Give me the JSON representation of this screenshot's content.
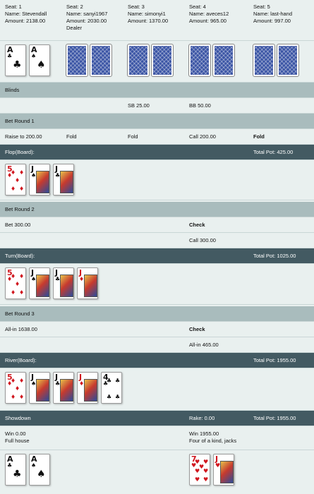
{
  "seats": [
    {
      "seat": "Seat: 1",
      "name": "Name: Stevendall",
      "amount": "Amount: 2138.00",
      "extra": ""
    },
    {
      "seat": "Seat: 2",
      "name": "Name: sanyi1967",
      "amount": "Amount: 2030.00",
      "extra": "Dealer"
    },
    {
      "seat": "Seat: 3",
      "name": "Name: simonyi1",
      "amount": "Amount: 1370.00",
      "extra": ""
    },
    {
      "seat": "Seat: 4",
      "name": "Name: aveces12",
      "amount": "Amount: 965.00",
      "extra": ""
    },
    {
      "seat": "Seat: 5",
      "name": "Name: last-hand",
      "amount": "Amount: 997.00",
      "extra": ""
    }
  ],
  "hole_cards": {
    "seat1": [
      {
        "rank": "A",
        "suit": "♣",
        "color": "black"
      },
      {
        "rank": "A",
        "suit": "♠",
        "color": "black"
      }
    ]
  },
  "blinds": {
    "header": "Blinds",
    "sb": "SB 25.00",
    "bb": "BB 50.00"
  },
  "bet_round_1": {
    "header": "Bet Round 1",
    "actions": [
      "Raise to 200.00",
      "Fold",
      "Fold",
      "Call 200.00",
      "Fold"
    ]
  },
  "flop": {
    "header": "Flop(Board):",
    "pot": "Total Pot: 425.00",
    "cards": [
      {
        "rank": "5",
        "suit": "♦",
        "color": "red"
      },
      {
        "rank": "J",
        "suit": "♠",
        "color": "black"
      },
      {
        "rank": "J",
        "suit": "♣",
        "color": "black"
      }
    ]
  },
  "bet_round_2": {
    "header": "Bet Round 2",
    "row1": {
      "seat1": "Bet 300.00",
      "seat4": "Check"
    },
    "row2": {
      "seat4": "Call 300.00"
    }
  },
  "turn": {
    "header": "Turn(Board):",
    "pot": "Total Pot: 1025.00",
    "cards": [
      {
        "rank": "5",
        "suit": "♦",
        "color": "red"
      },
      {
        "rank": "J",
        "suit": "♠",
        "color": "black"
      },
      {
        "rank": "J",
        "suit": "♣",
        "color": "black"
      },
      {
        "rank": "J",
        "suit": "♦",
        "color": "red"
      }
    ]
  },
  "bet_round_3": {
    "header": "Bet Round 3",
    "row1": {
      "seat1": "All-in 1638.00",
      "seat4": "Check"
    },
    "row2": {
      "seat4": "All-in 465.00"
    }
  },
  "river": {
    "header": "River(Board):",
    "pot": "Total Pot: 1955.00",
    "cards": [
      {
        "rank": "5",
        "suit": "♦",
        "color": "red"
      },
      {
        "rank": "J",
        "suit": "♠",
        "color": "black"
      },
      {
        "rank": "J",
        "suit": "♣",
        "color": "black"
      },
      {
        "rank": "J",
        "suit": "♦",
        "color": "red"
      },
      {
        "rank": "4",
        "suit": "♣",
        "color": "black"
      }
    ]
  },
  "showdown": {
    "header": "Showdown",
    "rake": "Rake: 0.00",
    "pot": "Total Pot: 1955.00",
    "seat1": {
      "win": "Win 0.00",
      "hand": "Full house",
      "cards": [
        {
          "rank": "A",
          "suit": "♣",
          "color": "black"
        },
        {
          "rank": "A",
          "suit": "♠",
          "color": "black"
        }
      ]
    },
    "seat4": {
      "win": "Win 1955.00",
      "hand": "Four of a kind, jacks",
      "cards": [
        {
          "rank": "7",
          "suit": "♥",
          "color": "red"
        },
        {
          "rank": "J",
          "suit": "♥",
          "color": "red"
        }
      ]
    }
  },
  "colors": {
    "header_dark": "#435a62",
    "header_grey": "#a9bcbd",
    "row_bg": "#e9f0ef",
    "card_back": "#3b55a5",
    "red_suit": "#d0161e"
  }
}
